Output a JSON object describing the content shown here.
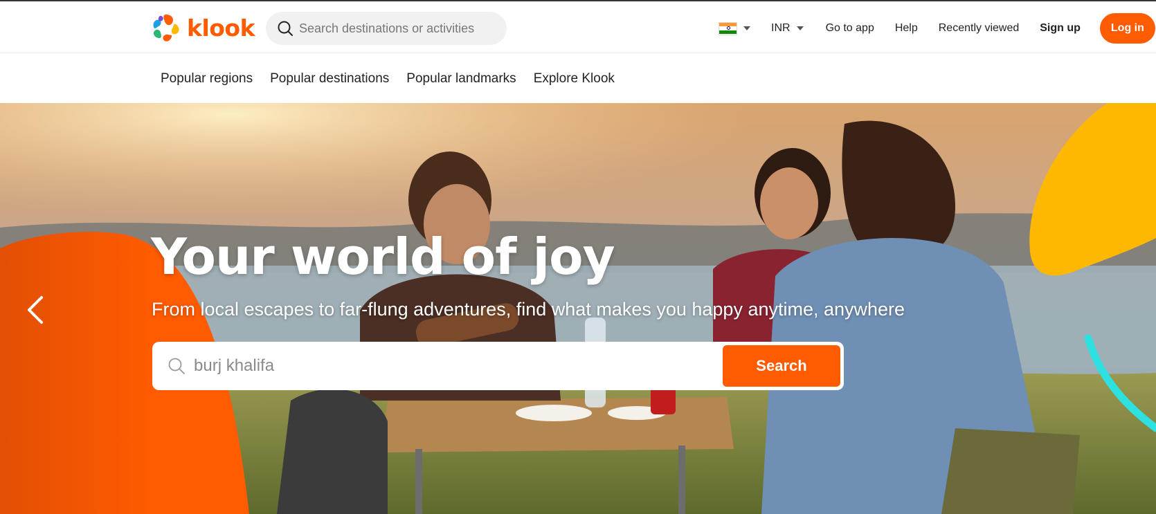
{
  "header": {
    "logo_text": "klook",
    "search_placeholder": "Search destinations or activities",
    "country": "India",
    "currency": "INR",
    "links": [
      "Go to app",
      "Help",
      "Recently viewed"
    ],
    "sign_up": "Sign up",
    "log_in": "Log in"
  },
  "subnav": {
    "items": [
      "Popular regions",
      "Popular destinations",
      "Popular landmarks",
      "Explore Klook"
    ]
  },
  "hero": {
    "title": "Your world of joy",
    "subtitle": "From local escapes to far-flung adventures, find what makes you happy anytime, anywhere",
    "search_value": "burj khalifa",
    "search_button": "Search"
  },
  "icons": {
    "search": "search-icon",
    "caret": "caret-down-icon",
    "prev": "chevron-left-icon"
  },
  "colors": {
    "brand": "#ff5b00",
    "accent_yellow": "#ffb800",
    "accent_cyan": "#2ee0e0"
  }
}
